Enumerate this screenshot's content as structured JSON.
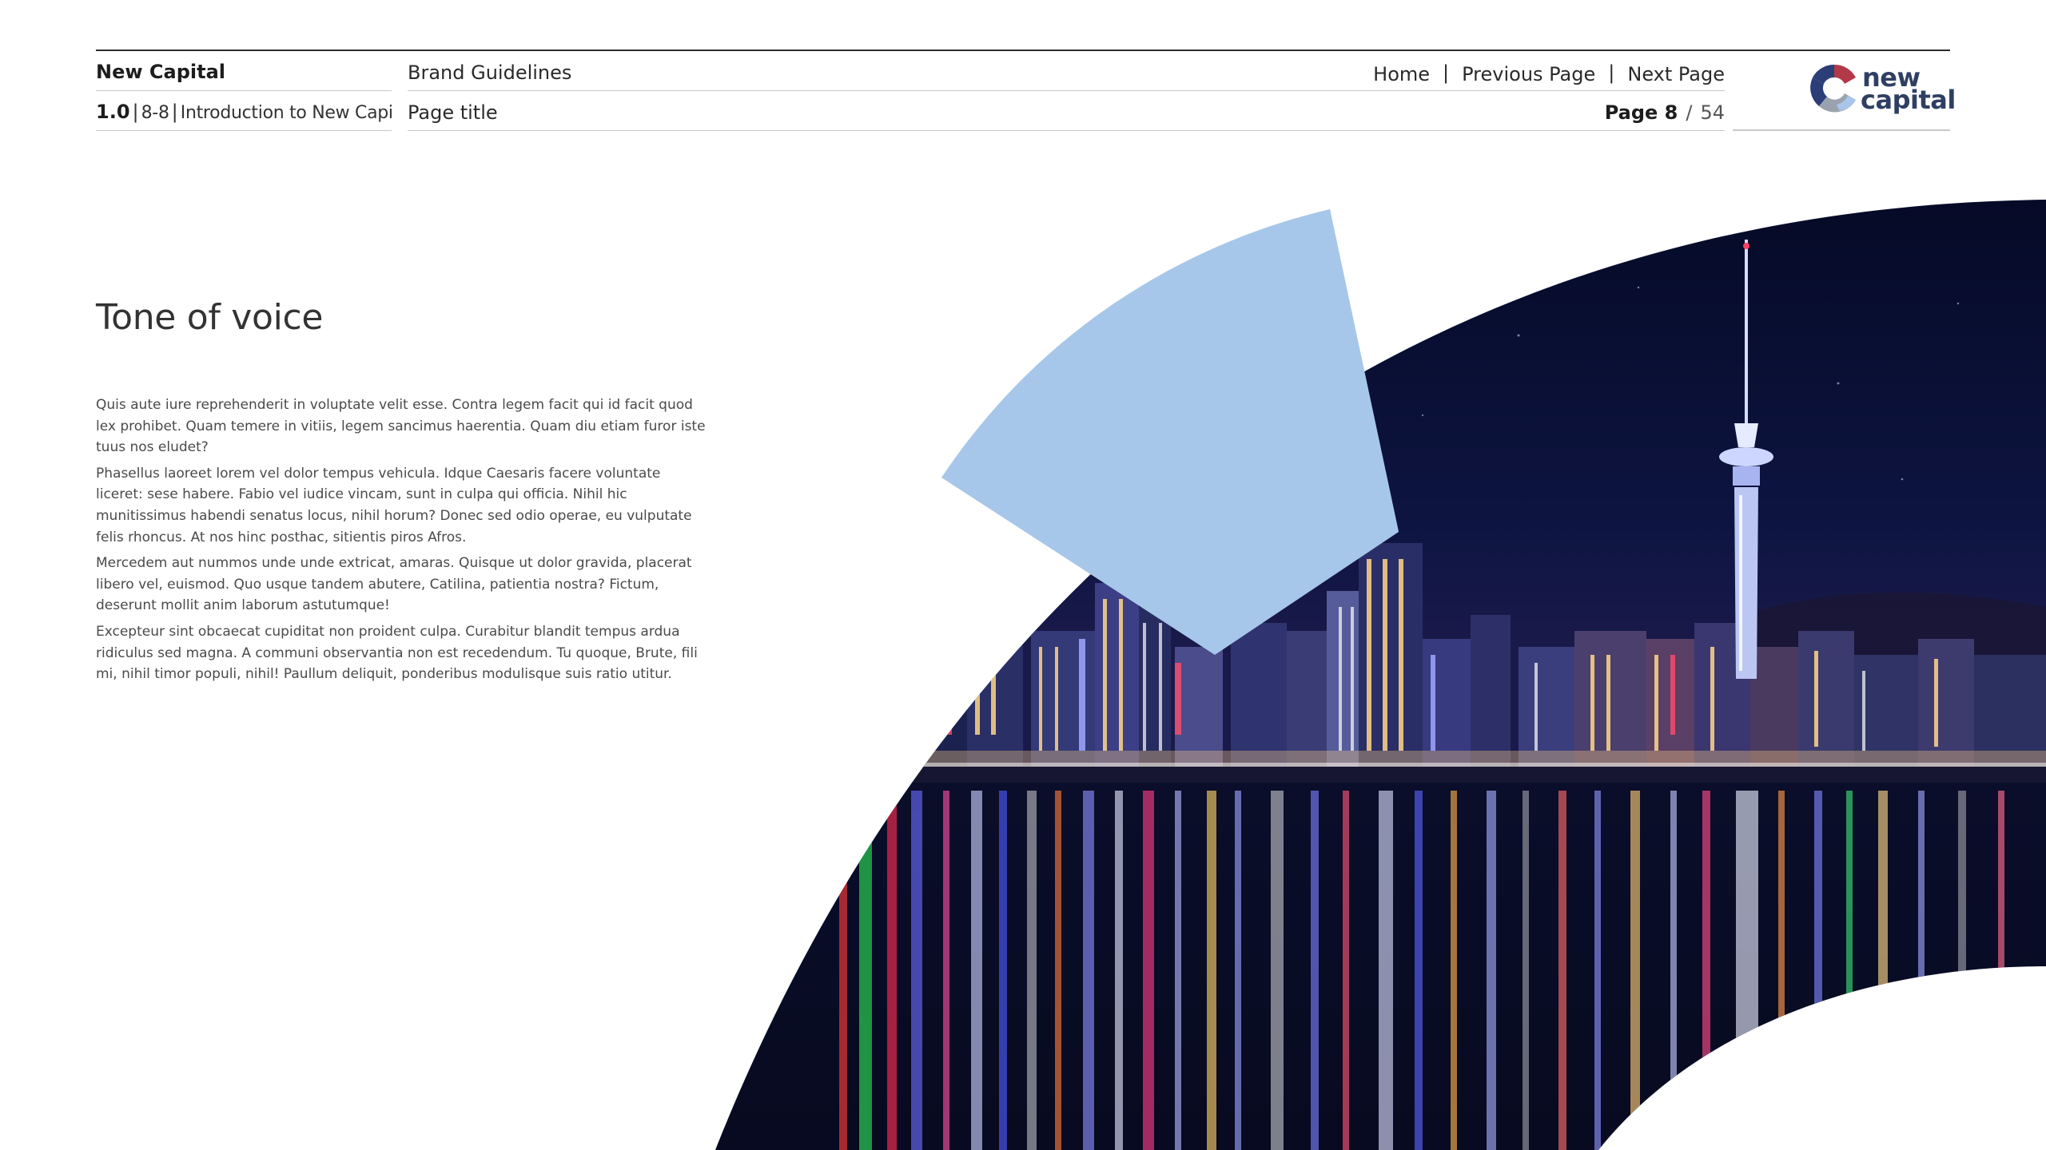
{
  "header": {
    "brand_name": "New Capital",
    "section_number": "1.0",
    "section_range": "8-8",
    "section_title": "Introduction to New Capital",
    "document_title": "Brand Guidelines",
    "page_title": "Page title",
    "nav": {
      "home": "Home",
      "previous": "Previous Page",
      "next": "Next Page",
      "separator": "|"
    },
    "page_current": "Page 8",
    "page_separator": "/",
    "page_total": "54"
  },
  "logo": {
    "line1": "new",
    "line2": "capital",
    "colors": {
      "text": "#2f3f63",
      "navy": "#2c3e78",
      "red": "#b23a48",
      "grey": "#9aa3ad",
      "light_blue": "#a9c6ea"
    }
  },
  "main": {
    "title": "Tone of voice",
    "paragraphs": [
      "Quis aute iure reprehenderit in voluptate velit esse. Contra legem facit qui id facit quod lex prohibet. Quam temere in vitiis, legem sancimus haerentia. Quam diu etiam furor iste tuus nos eludet?",
      "Phasellus laoreet lorem vel dolor tempus vehicula. Idque Caesaris facere voluntate liceret: sese habere. Fabio vel iudice vincam, sunt in culpa qui officia. Nihil hic munitissimus habendi senatus locus, nihil horum? Donec sed odio operae, eu vulputate felis rhoncus. At nos hinc posthac, sitientis piros Afros.",
      "Mercedem aut nummos unde unde extricat, amaras. Quisque ut dolor gravida, placerat libero vel, euismod. Quo usque tandem abutere, Catilina, patientia nostra? Fictum, deserunt mollit anim laborum astutumque!",
      "Excepteur sint obcaecat cupiditat non proident culpa. Curabitur blandit tempus ardua ridiculus sed magna. A communi observantia non est recedendum. Tu quoque, Brute, fili mi, nihil timor populi, nihil! Paullum deliquit, ponderibus modulisque suis ratio utitur."
    ]
  },
  "artwork": {
    "image_subject": "city-skyline-night-photo",
    "accent_color": "#a7c7ea",
    "sky_color": "#0a0f33"
  }
}
